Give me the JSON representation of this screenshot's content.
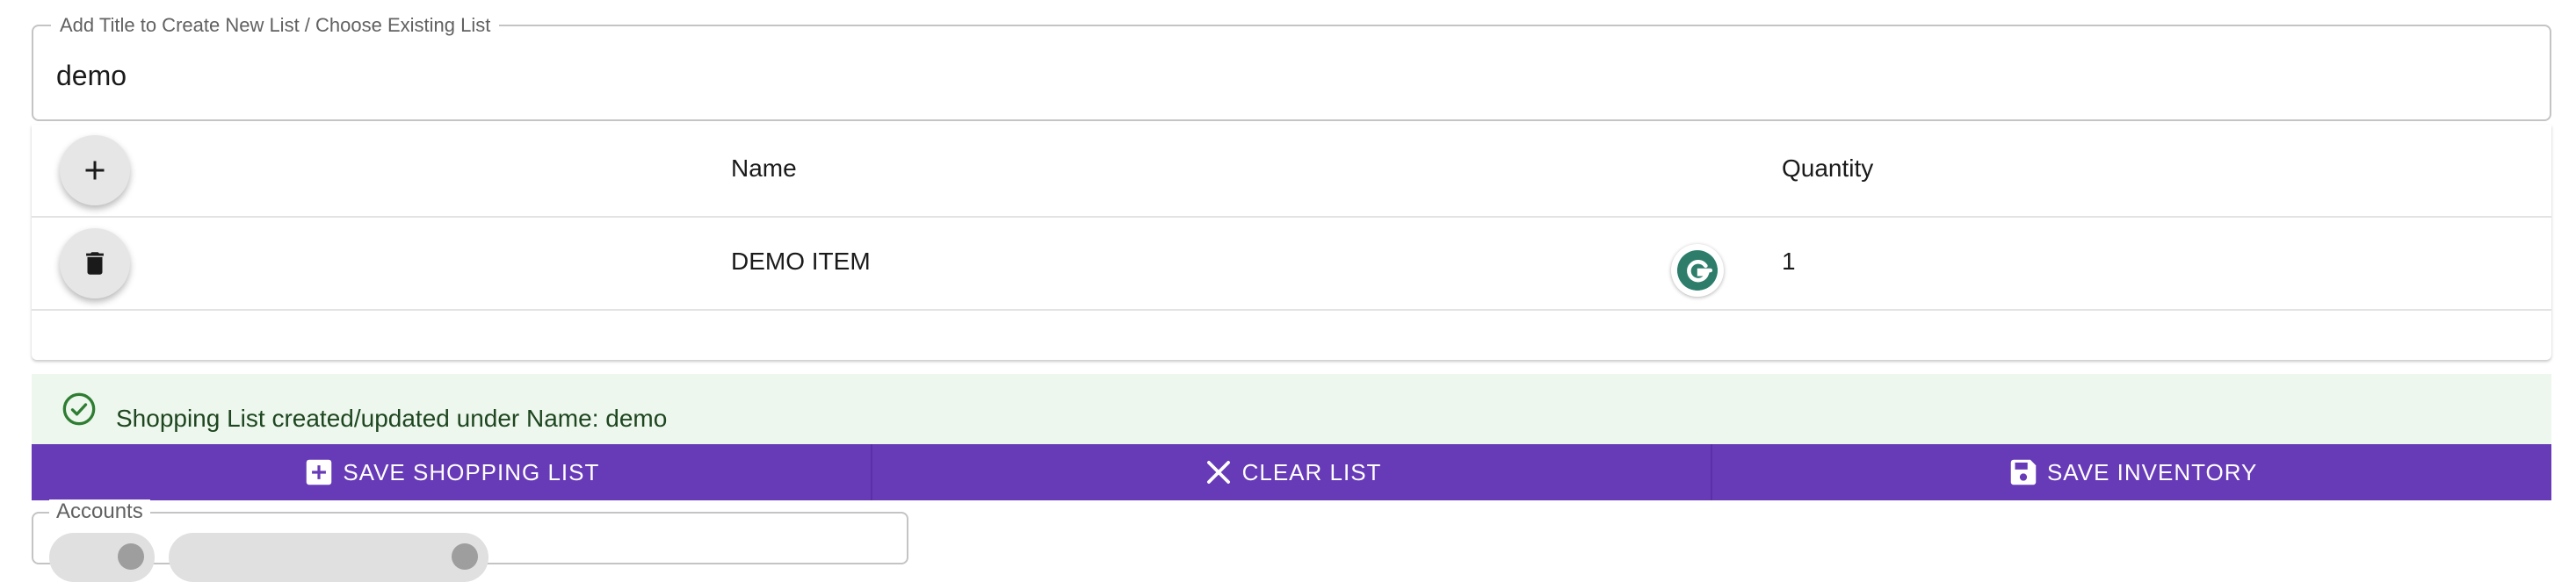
{
  "title_field": {
    "label": "Add Title to Create New List / Choose Existing List",
    "value": "demo"
  },
  "table": {
    "headers": {
      "name": "Name",
      "quantity": "Quantity"
    },
    "rows": [
      {
        "name": "DEMO ITEM",
        "quantity": "1"
      }
    ]
  },
  "alert": {
    "message": "Shopping List created/updated under Name: demo"
  },
  "actions": {
    "save_shopping_list": "SAVE SHOPPING LIST",
    "clear_list": "CLEAR LIST",
    "save_inventory": "SAVE INVENTORY"
  },
  "accounts": {
    "label": "Accounts"
  },
  "icons": {
    "add": "plus-icon",
    "delete": "trash-icon",
    "grammarly": "grammarly-icon",
    "success": "check-circle-icon",
    "add_box": "add-box-icon",
    "clear": "close-icon",
    "save": "floppy-disk-icon"
  },
  "colors": {
    "primary": "#673ab7",
    "success_bg": "#edf7ed",
    "success_fg": "#2e7d32"
  }
}
